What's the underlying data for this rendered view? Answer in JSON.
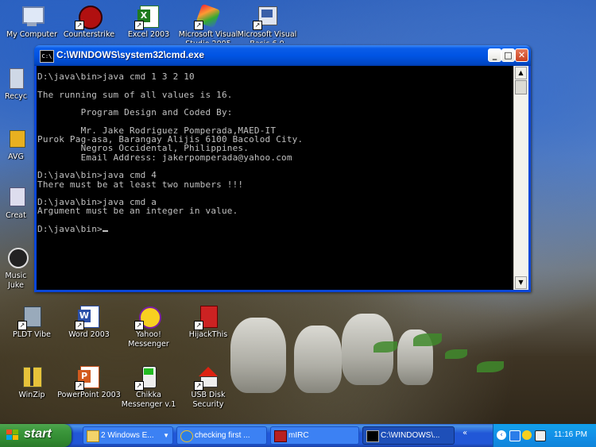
{
  "desktop_icons": [
    {
      "label": "My Computer",
      "icon": "computer-icon"
    },
    {
      "label": "Counterstrike",
      "icon": "game-icon"
    },
    {
      "label": "Excel 2003",
      "icon": "excel-icon"
    },
    {
      "label": "Microsoft Visual Studio 2005",
      "icon": "visual-studio-icon"
    },
    {
      "label": "Microsoft Visual Basic 6.0",
      "icon": "visual-basic-icon"
    },
    {
      "label": "Recyc",
      "icon": "recycle-bin-icon"
    },
    {
      "label": "AVG",
      "icon": "antivirus-icon"
    },
    {
      "label": "Creat",
      "icon": "app-icon"
    },
    {
      "label": "Music Juke",
      "icon": "music-icon"
    },
    {
      "label": "PLDT Vibe",
      "icon": "network-icon"
    },
    {
      "label": "Word 2003",
      "icon": "word-icon"
    },
    {
      "label": "Yahoo! Messenger",
      "icon": "yahoo-messenger-icon"
    },
    {
      "label": "HijackThis",
      "icon": "hijackthis-icon"
    },
    {
      "label": "WinZip",
      "icon": "winzip-icon"
    },
    {
      "label": "PowerPoint 2003",
      "icon": "powerpoint-icon"
    },
    {
      "label": "Chikka Messenger v.1",
      "icon": "chikka-icon"
    },
    {
      "label": "USB Disk Security",
      "icon": "usb-security-icon"
    }
  ],
  "window": {
    "title": "C:\\WINDOWS\\system32\\cmd.exe",
    "icon_text": "C:\\",
    "buttons": {
      "minimize": "_",
      "maximize": "□",
      "close": "✕"
    },
    "console_lines": [
      "D:\\java\\bin>java cmd 1 3 2 10",
      "",
      "The running sum of all values is 16.",
      "",
      "        Program Design and Coded By:",
      "",
      "        Mr. Jake Rodriguez Pomperada,MAED-IT",
      "Purok Pag-asa, Barangay Alijis 6100 Bacolod City.",
      "        Negros Occidental, Philippines.",
      "        Email Address: jakerpomperada@yahoo.com",
      "",
      "D:\\java\\bin>java cmd 4",
      "There must be at least two numbers !!!",
      "",
      "D:\\java\\bin>java cmd a",
      "Argument must be an integer in value.",
      "",
      "D:\\java\\bin>"
    ]
  },
  "taskbar": {
    "start_label": "start",
    "tasks": [
      {
        "label": "2 Windows E...",
        "icon": "folder-icon"
      },
      {
        "label": "checking first ...",
        "icon": "internet-explorer-icon"
      },
      {
        "label": "mIRC",
        "icon": "mirc-icon"
      },
      {
        "label": "C:\\WINDOWS\\...",
        "icon": "cmd-icon"
      }
    ],
    "clock": "11:16 PM"
  },
  "colors": {
    "console_bg": "#000000",
    "console_text": "#c0c0c0",
    "titlebar": "#0054e3",
    "start_green": "#3c973c",
    "taskbar_blue": "#2157d7"
  }
}
